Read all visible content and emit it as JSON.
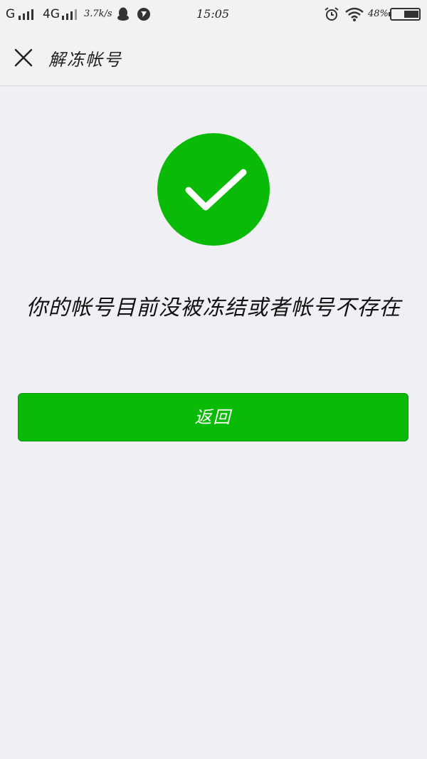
{
  "status_bar": {
    "carrier1": "G",
    "carrier2": "4G",
    "net_speed": "3.7k/s",
    "time": "15:05",
    "battery_pct": "48%",
    "icons": [
      "signal-icon",
      "signal-icon",
      "qq-icon",
      "browser-icon",
      "alarm-icon",
      "wifi-icon",
      "battery-icon"
    ]
  },
  "header": {
    "close_icon": "close-icon",
    "title": "解冻帐号"
  },
  "main": {
    "success_icon": "check-circle-icon",
    "success_color": "#09bb07",
    "message": "你的帐号目前没被冻结或者帐号不存在",
    "back_button_label": "返回"
  }
}
